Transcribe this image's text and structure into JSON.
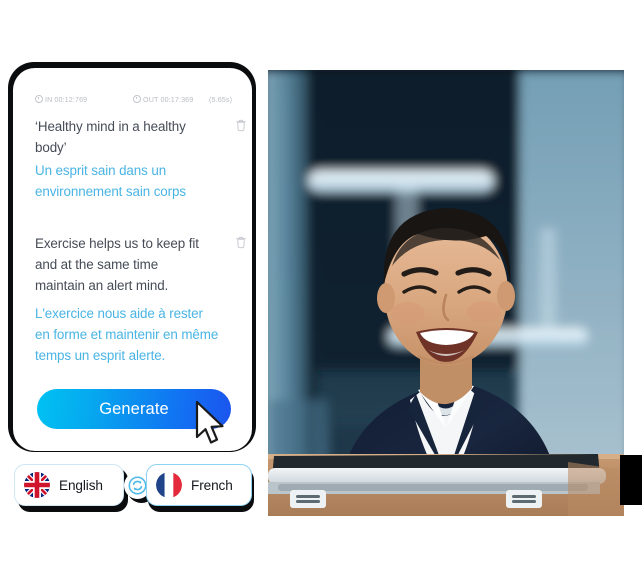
{
  "editor": {
    "meta": {
      "in_label": "IN",
      "in_time": "00:12:769",
      "out_label": "OUT",
      "out_time": "00:17:369",
      "duration": "(5.65s)"
    },
    "segments": [
      {
        "source_text": "‘Healthy mind in a healthy body’",
        "target_text": "Un esprit sain dans un environnement sain corps",
        "delete_icon": "trash-icon"
      },
      {
        "source_text": "Exercise helps us to keep fit and at the same time maintain an alert mind.",
        "target_text": "L'exercice nous aide à rester en forme et maintenir en même temps un esprit alerte.",
        "delete_icon": "trash-icon"
      }
    ],
    "generate_button": {
      "label": "Generate",
      "gradient_start": "#00c2f2",
      "gradient_end": "#1b54ee"
    }
  },
  "language_bar": {
    "source": {
      "label": "English",
      "flag": "uk-flag-icon"
    },
    "swap": {
      "icon": "swap-refresh-icon",
      "color": "#4fb9e8"
    },
    "target": {
      "label": "French",
      "flag": "france-flag-icon",
      "selected": true
    }
  },
  "photo": {
    "description": "smiling-man-in-office",
    "alt": "Smiling man in navy blazer and white shirt seated at a desk with a laptop in a modern office"
  },
  "colors": {
    "source_text": "#464c57",
    "target_text": "#49b4e4",
    "meta_text": "#b9bcc2",
    "card_background": "#ffffff",
    "frame": "#0b0c0e"
  }
}
